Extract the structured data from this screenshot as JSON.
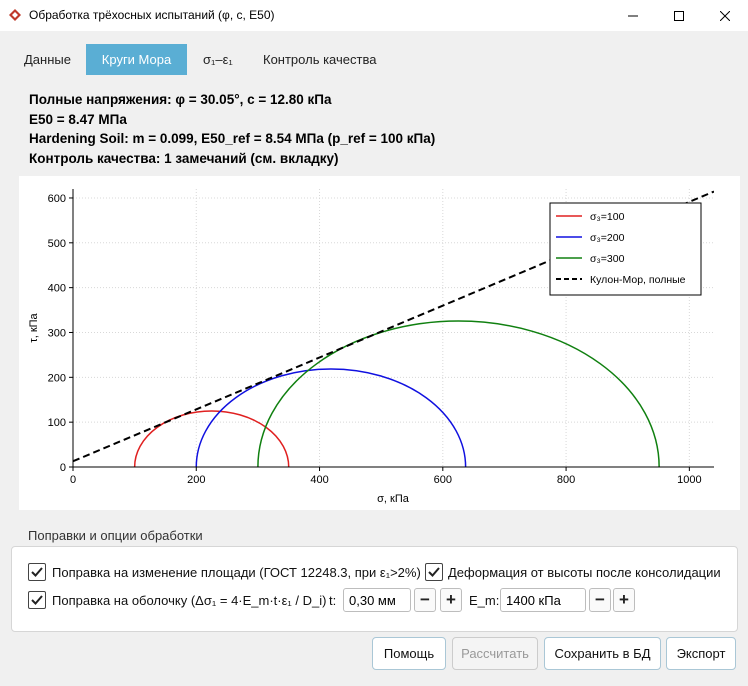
{
  "window": {
    "title": "Обработка трёхосных испытаний (φ, c, E50)",
    "minimize_glyph": "—",
    "maximize_glyph": "☐",
    "close_glyph": "✕"
  },
  "tabs": [
    {
      "label": "Данные",
      "active": false
    },
    {
      "label": "Круги Мора",
      "active": true
    },
    {
      "label": "σ₁–ε₁",
      "active": false
    },
    {
      "label": "Контроль качества",
      "active": false
    }
  ],
  "summary": {
    "line1": "Полные напряжения: φ = 30.05°,  c = 12.80 кПа",
    "line2": "E50 = 8.47 МПа",
    "line3": "Hardening Soil: m = 0.099, E50_ref = 8.54 МПа (p_ref = 100 кПа)",
    "line4": "Контроль качества: 1 замечаний (см. вкладку)"
  },
  "chart_data": {
    "type": "line",
    "xlabel": "σ, кПа",
    "ylabel": "τ, кПа",
    "xlim": [
      0,
      1040
    ],
    "ylim": [
      0,
      620
    ],
    "x_ticks": [
      0,
      200,
      400,
      600,
      800,
      1000
    ],
    "y_ticks": [
      0,
      100,
      200,
      300,
      400,
      500,
      600
    ],
    "grid": true,
    "legend_position": "top-right",
    "circles": [
      {
        "name": "σ₃=100",
        "sigma3": 100,
        "sigma1": 350,
        "color": "#e02020"
      },
      {
        "name": "σ₃=200",
        "sigma3": 200,
        "sigma1": 637,
        "color": "#1010e0"
      },
      {
        "name": "σ₃=300",
        "sigma3": 300,
        "sigma1": 951,
        "color": "#108010"
      }
    ],
    "envelope": {
      "name": "Кулон-Мор, полные",
      "phi_deg": 30.05,
      "c": 12.8,
      "color": "#000000",
      "dash": true
    }
  },
  "options": {
    "group_title": "Поправки и опции обработки",
    "area_correction": {
      "label": "Поправка на изменение площади (ГОСТ 12248.3, при ε₁>2%)",
      "checked": true
    },
    "height_deformation": {
      "label": "Деформация от высоты после консолидации",
      "checked": true
    },
    "membrane_correction": {
      "label": "Поправка на оболочку (Δσ₁ = 4·E_m·t·ε₁ / D_i)",
      "checked": true
    },
    "t_label": "t:",
    "t_value": "0,30 мм",
    "em_label": "E_m:",
    "em_value": "1400 кПа",
    "minus": "−",
    "plus": "+"
  },
  "buttons": {
    "help": "Помощь",
    "calculate": "Рассчитать",
    "save_db": "Сохранить в БД",
    "export": "Экспорт"
  }
}
